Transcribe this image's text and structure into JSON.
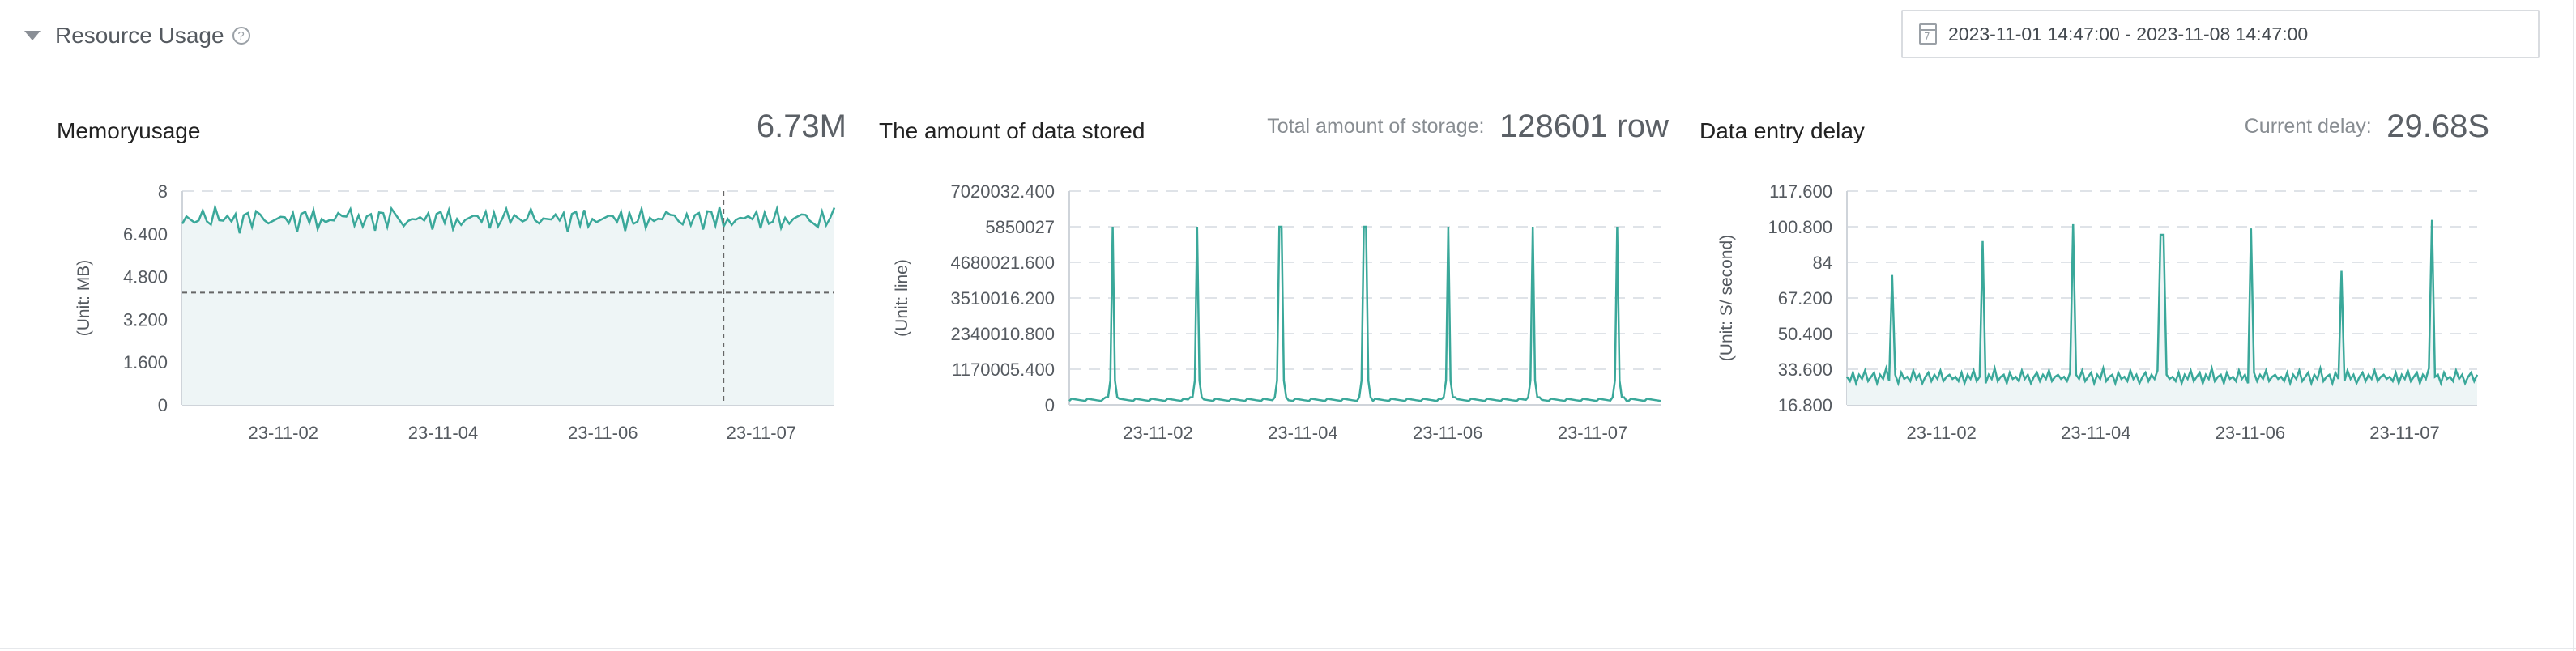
{
  "header": {
    "title": "Resource Usage",
    "help_icon": "question-circle-icon",
    "caret_icon": "caret-down-icon"
  },
  "daterange": {
    "value": "2023-11-01 14:47:00 - 2023-11-08 14:47:00",
    "icon": "calendar-icon"
  },
  "colors": {
    "line": "#3aa89a",
    "fill": "#eef5f6",
    "grid": "#dfe3e8",
    "axis": "#555a60"
  },
  "panels": [
    {
      "title": "Memoryusage",
      "metric_label": "",
      "metric_value": "6.73M"
    },
    {
      "title": "The amount of data stored",
      "metric_label": "Total amount of storage:",
      "metric_value": "128601 row"
    },
    {
      "title": "Data entry delay",
      "metric_label": "Current delay:",
      "metric_value": "29.68S"
    }
  ],
  "chart_data": [
    {
      "type": "area",
      "title": "",
      "ylabel": "(Unit: MB)",
      "ylim": [
        0,
        8
      ],
      "yticks": [
        "8",
        "6.400",
        "4.800",
        "3.200",
        "1.600",
        "0"
      ],
      "xticks": [
        "23-11-02",
        "23-11-04",
        "23-11-06",
        "23-11-07"
      ],
      "x": [
        "2023-11-01 14:47",
        "2023-11-08 14:47"
      ],
      "series": [
        {
          "values": [
            7.0,
            7.1,
            6.8,
            7.0,
            6.9,
            7.1,
            7.0,
            6.7,
            7.2,
            7.0,
            6.8,
            7.3,
            6.9,
            7.0,
            6.6,
            7.1,
            7.0,
            6.8,
            7.2,
            6.9,
            7.0,
            6.7,
            7.1,
            7.0,
            6.9,
            7.2,
            6.8,
            7.0,
            6.6,
            7.1,
            7.0,
            6.9,
            7.2,
            6.8,
            7.0,
            6.7,
            7.1,
            6.9,
            7.0,
            7.2
          ]
        }
      ],
      "crosshair": {
        "x": "23-11-07",
        "y": 4.2
      },
      "grid": true
    },
    {
      "type": "line",
      "title": "",
      "ylabel": "(Unit: line)",
      "ylim": [
        0,
        7020032.4
      ],
      "yticks": [
        "7020032.400",
        "5850027",
        "4680021.600",
        "3510016.200",
        "2340010.800",
        "1170005.400",
        "0"
      ],
      "xticks": [
        "23-11-02",
        "23-11-04",
        "23-11-06",
        "23-11-07"
      ],
      "x": [
        "2023-11-01 14:47",
        "2023-11-08 14:47"
      ],
      "spikes": [
        5850027,
        5850027,
        5850027,
        5850027,
        5850027,
        5850027,
        5850027
      ],
      "baseline": 128601,
      "grid": true
    },
    {
      "type": "area",
      "title": "",
      "ylabel": "(Unit: S/ second)",
      "ylim": [
        16.8,
        117.6
      ],
      "yticks": [
        "117.600",
        "100.800",
        "84",
        "67.200",
        "50.400",
        "33.600",
        "16.800"
      ],
      "xticks": [
        "23-11-02",
        "23-11-04",
        "23-11-06",
        "23-11-07"
      ],
      "x": [
        "2023-11-01 14:47",
        "2023-11-08 14:47"
      ],
      "baseline_values": [
        30,
        28,
        32,
        27,
        31,
        29,
        33,
        28,
        30,
        32,
        27,
        31,
        29,
        34,
        28,
        30,
        31,
        27,
        32,
        29,
        30,
        28,
        33,
        29,
        31,
        27,
        30,
        32,
        28,
        31,
        29,
        33,
        28,
        30,
        31,
        29
      ],
      "spikes": [
        78,
        94,
        102,
        97,
        100,
        80,
        104
      ],
      "grid": true
    }
  ]
}
